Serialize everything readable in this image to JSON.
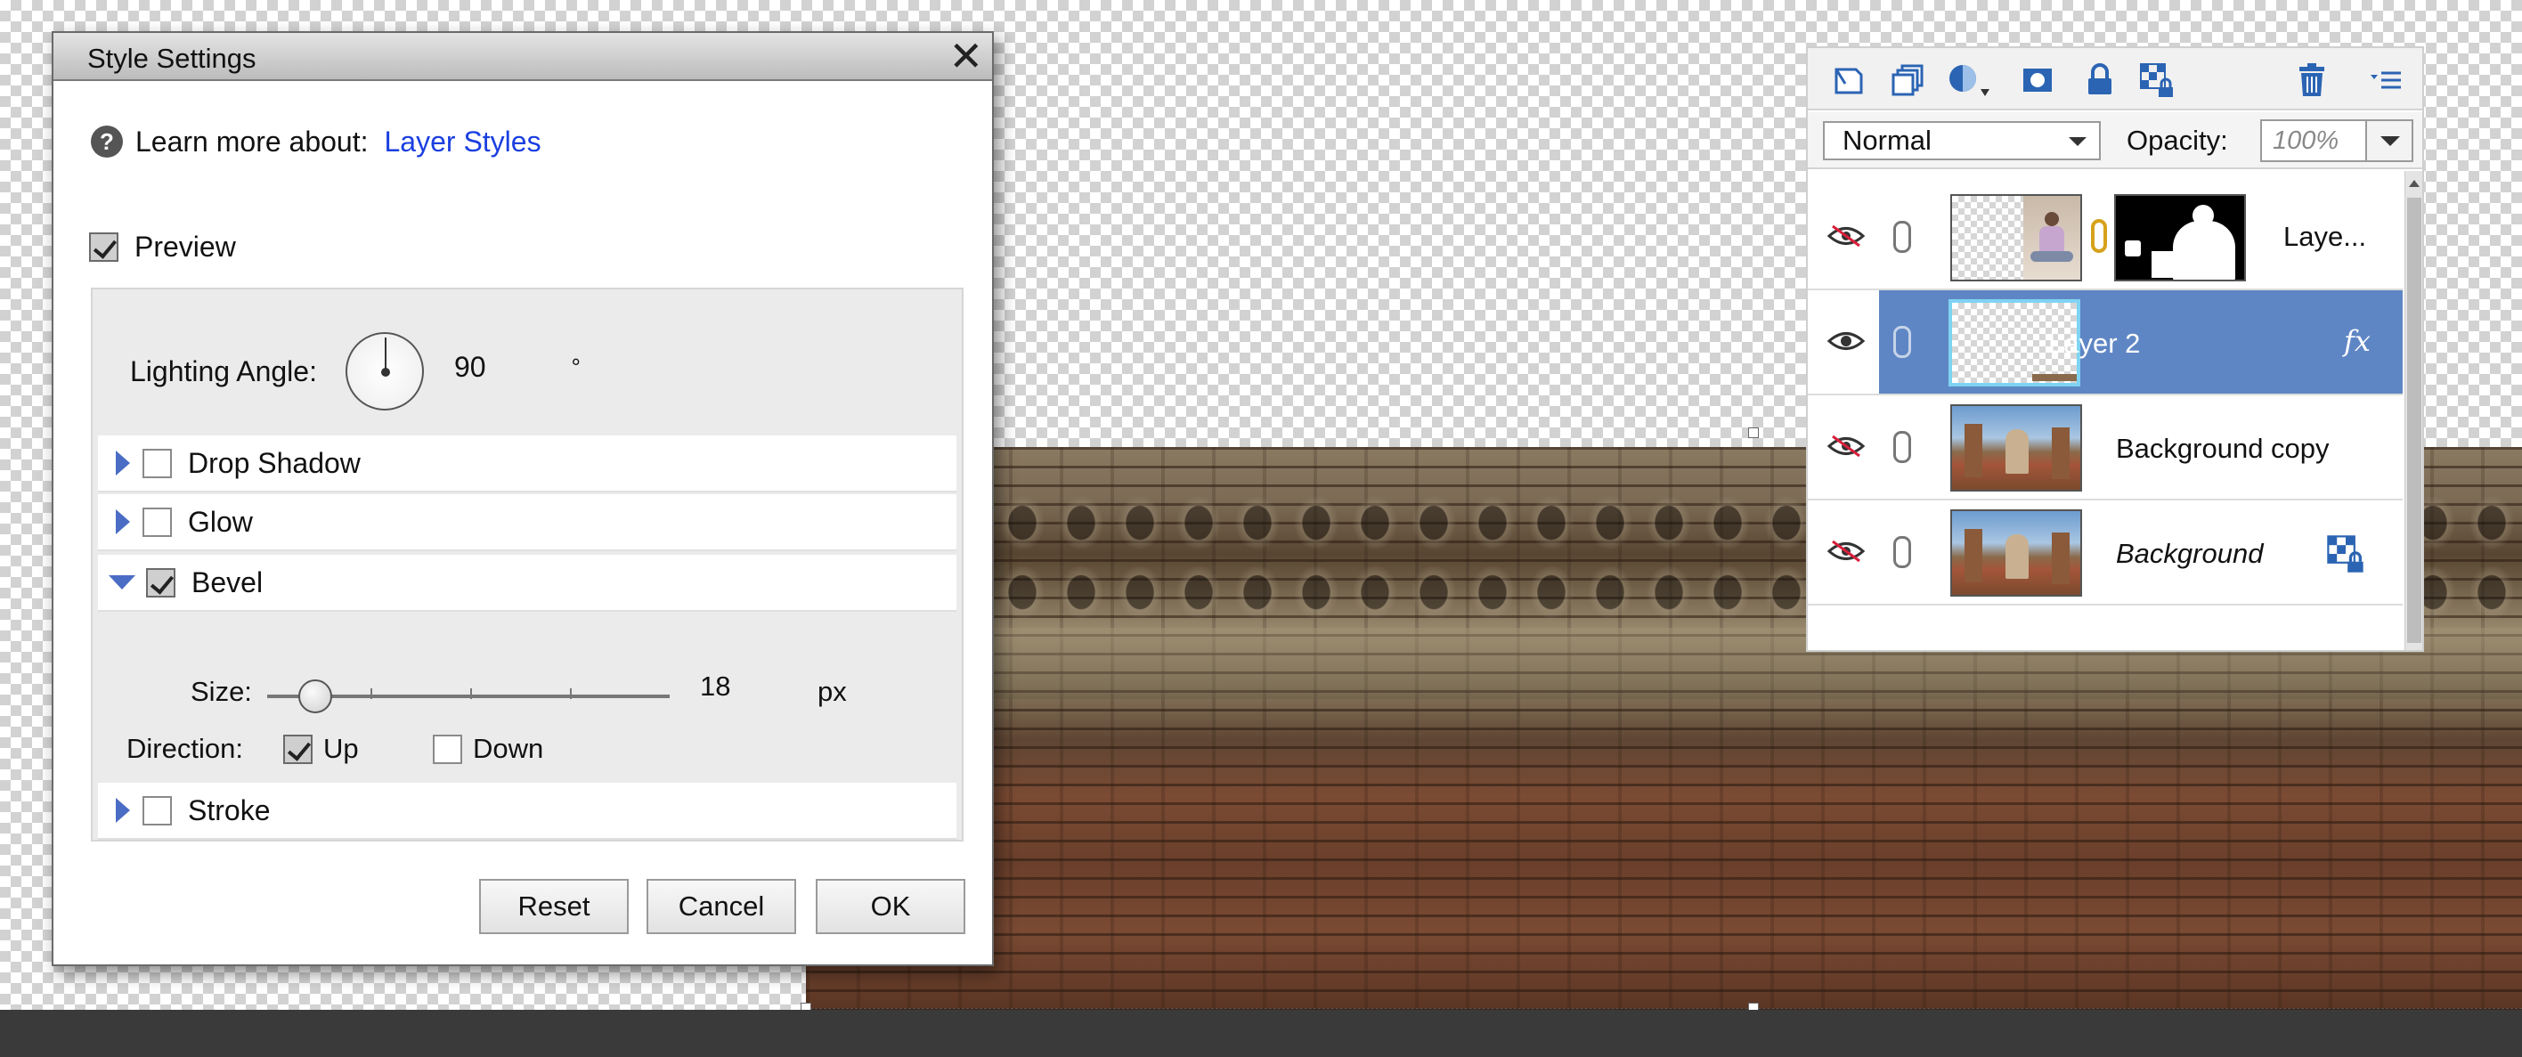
{
  "dialog": {
    "title": "Style Settings",
    "help_label": "Learn more about:",
    "help_link": "Layer Styles",
    "preview_label": "Preview",
    "preview_checked": true,
    "lighting_angle_label": "Lighting Angle:",
    "lighting_angle_value": "90",
    "lighting_angle_unit": "°",
    "styles": [
      {
        "label": "Drop Shadow",
        "checked": false,
        "expanded": false
      },
      {
        "label": "Glow",
        "checked": false,
        "expanded": false
      },
      {
        "label": "Bevel",
        "checked": true,
        "expanded": true
      },
      {
        "label": "Stroke",
        "checked": false,
        "expanded": false
      }
    ],
    "bevel": {
      "size_label": "Size:",
      "size_value": "18",
      "size_unit": "px",
      "size_fraction": 0.12,
      "direction_label": "Direction:",
      "direction_up_label": "Up",
      "direction_up_checked": true,
      "direction_down_label": "Down",
      "direction_down_checked": false
    },
    "buttons": {
      "reset": "Reset",
      "cancel": "Cancel",
      "ok": "OK"
    }
  },
  "layers_panel": {
    "toolbar_icons": [
      "new-layer-icon",
      "duplicate-layer-icon",
      "adjustment-layer-icon",
      "layer-mask-icon",
      "lock-icon",
      "lock-transparent-icon",
      "delete-layer-icon",
      "panel-menu-icon"
    ],
    "blend_mode": "Normal",
    "opacity_label": "Opacity:",
    "opacity_value": "100%",
    "layers": [
      {
        "name": "Laye...",
        "visible": false,
        "selected": false,
        "has_mask": true,
        "thumb": "transparent-with-figure"
      },
      {
        "name": "Layer 2",
        "visible": true,
        "selected": true,
        "has_fx": true,
        "fx_label": "fx",
        "thumb": "transparent"
      },
      {
        "name": "Background copy",
        "visible": false,
        "selected": false,
        "thumb": "photo"
      },
      {
        "name": "Background",
        "visible": false,
        "selected": false,
        "italic": true,
        "locked": true,
        "thumb": "photo"
      }
    ]
  },
  "colors": {
    "link_blue": "#1a3fe0",
    "selection_blue": "#5f86c4",
    "expander_blue": "#4a6cc4"
  }
}
